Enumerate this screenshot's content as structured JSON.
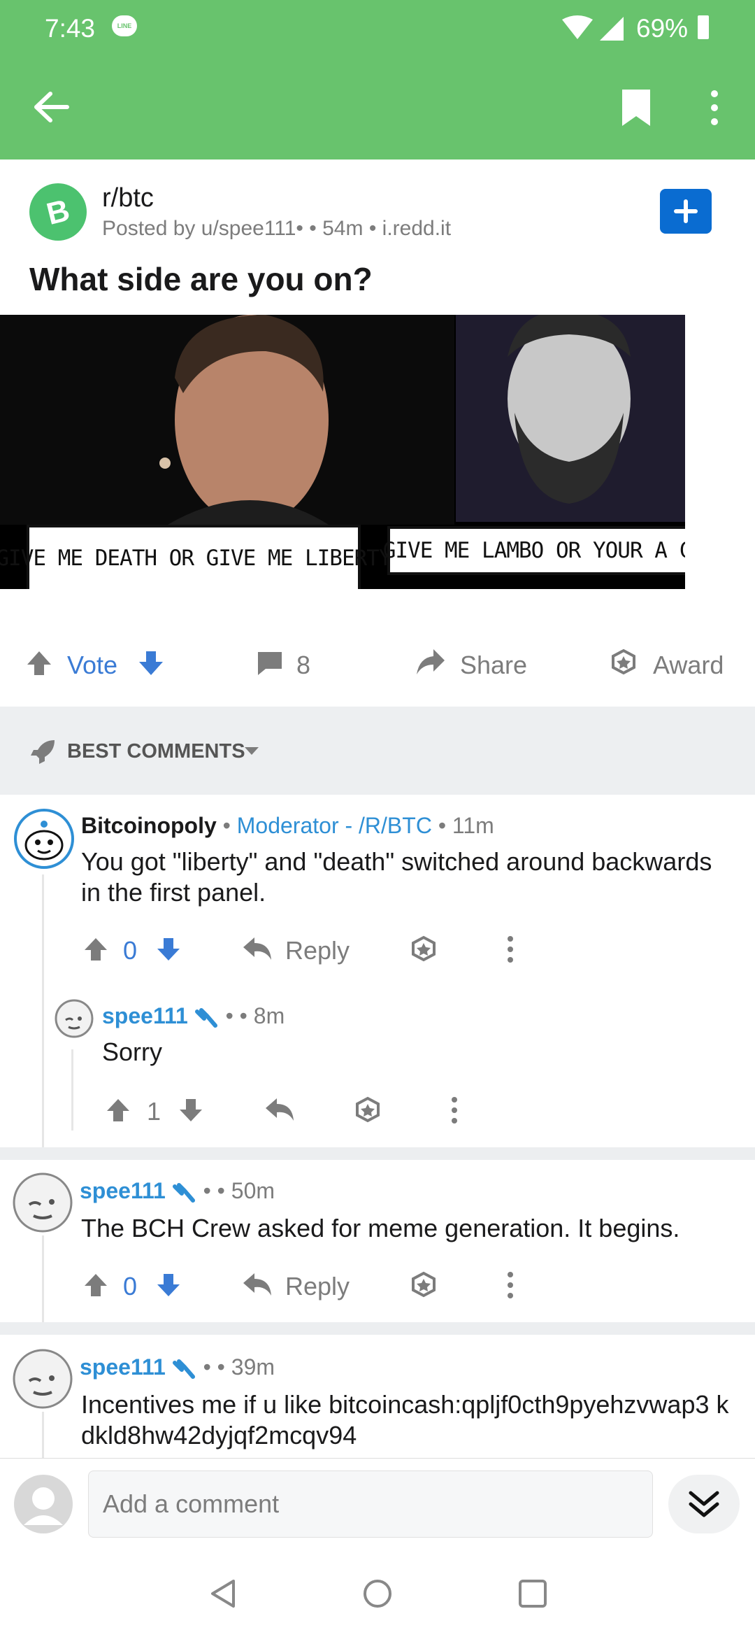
{
  "status_bar": {
    "time": "7:43",
    "line_badge": "LINE",
    "battery": "69%"
  },
  "colors": {
    "app_bar": "#68c36d",
    "upvote_blue": "#3a7bd5",
    "username_blue": "#2e8fd5",
    "plus_button": "#0a6cd1",
    "bch_green": "#4cc26f"
  },
  "post": {
    "subreddit": "r/btc",
    "posted_by": "Posted by u/spee111•",
    "age": "• 54m",
    "domain": "• i.redd.it",
    "title": "What side are you on?",
    "meme_left": "GIVE ME DEATH OR GIVE ME LIBERTY",
    "meme_right": "GIVE ME LAMBO OR YOUR A C**T"
  },
  "actions": {
    "vote": "Vote",
    "comments": "8",
    "share": "Share",
    "award": "Award"
  },
  "sort": {
    "label": "BEST COMMENTS"
  },
  "comments": [
    {
      "author": "Bitcoinopoly",
      "flair": "Moderator - /R/BTC",
      "age": "• 11m",
      "body": "You got \"liberty\" and \"death\" switched around backwards in the first panel.",
      "votes": "0",
      "reply": "Reply",
      "replies": [
        {
          "author": "spee111",
          "age": "• 8m",
          "body": "Sorry",
          "votes": "1"
        }
      ]
    },
    {
      "author": "spee111",
      "age": "• 50m",
      "body": "The BCH Crew asked for meme generation. It begins.",
      "votes": "0",
      "reply": "Reply"
    },
    {
      "author": "spee111",
      "age": "• 39m",
      "body": "Incentives me if u like bitcoincash:qpljf0cth9pyehzvwap3 kdkld8hw42dyjqf2mcqv94"
    }
  ],
  "composer": {
    "placeholder": "Add a comment"
  }
}
